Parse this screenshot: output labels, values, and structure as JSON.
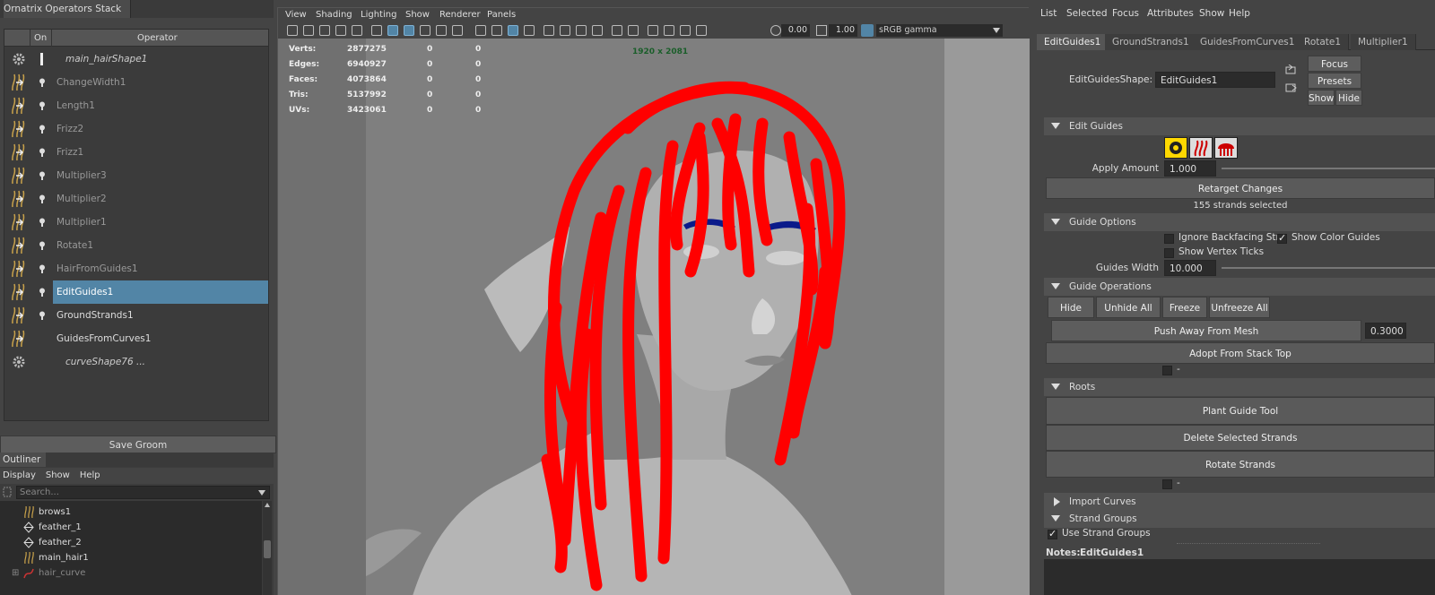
{
  "ornatrix": {
    "title": "Ornatrix Operators Stack",
    "col_on": "On",
    "col_operator": "Operator",
    "operators": [
      {
        "name": "main_hairShape1",
        "icon": "gear-icon"
      },
      {
        "name": "ChangeWidth1",
        "icon": "change-width-icon"
      },
      {
        "name": "Length1",
        "icon": "length-icon"
      },
      {
        "name": "Frizz2",
        "icon": "frizz-icon"
      },
      {
        "name": "Frizz1",
        "icon": "frizz-icon"
      },
      {
        "name": "Multiplier3",
        "icon": "multiplier-icon"
      },
      {
        "name": "Multiplier2",
        "icon": "multiplier-icon"
      },
      {
        "name": "Multiplier1",
        "icon": "multiplier-icon"
      },
      {
        "name": "Rotate1",
        "icon": "rotate-icon"
      },
      {
        "name": "HairFromGuides1",
        "icon": "hair-from-guides-icon"
      },
      {
        "name": "EditGuides1",
        "icon": "edit-guides-icon"
      },
      {
        "name": "GroundStrands1",
        "icon": "ground-strands-icon"
      },
      {
        "name": "GuidesFromCurves1",
        "icon": "guides-from-curves-icon"
      },
      {
        "name": "curveShape76 ...",
        "icon": "gear-icon"
      }
    ],
    "save_label": "Save Groom"
  },
  "outliner": {
    "title": "Outliner",
    "menu": [
      "Display",
      "Show",
      "Help"
    ],
    "search_placeholder": "Search...",
    "items": [
      {
        "name": "brows1",
        "icon": "hair-icon"
      },
      {
        "name": "feather_1",
        "icon": "mesh-icon"
      },
      {
        "name": "feather_2",
        "icon": "mesh-icon"
      },
      {
        "name": "main_hair1",
        "icon": "hair-icon"
      },
      {
        "name": "hair_curve",
        "icon": "curve-icon"
      }
    ]
  },
  "viewport": {
    "menu": [
      "View",
      "Shading",
      "Lighting",
      "Show",
      "Renderer",
      "Panels"
    ],
    "exposure": "0.00",
    "gamma": "1.00",
    "color_space": "sRGB gamma",
    "resolution": "1920 x 2081",
    "hud": [
      {
        "label": "Verts:",
        "v1": "2877275",
        "v2": "0",
        "v3": "0"
      },
      {
        "label": "Edges:",
        "v1": "6940927",
        "v2": "0",
        "v3": "0"
      },
      {
        "label": "Faces:",
        "v1": "4073864",
        "v2": "0",
        "v3": "0"
      },
      {
        "label": "Tris:",
        "v1": "5137992",
        "v2": "0",
        "v3": "0"
      },
      {
        "label": "UVs:",
        "v1": "3423061",
        "v2": "0",
        "v3": "0"
      }
    ],
    "colors": {
      "hair": "#ff0000",
      "brows": "#0a1a8a",
      "skin": "#9a9a9a",
      "bg": "#707070"
    }
  },
  "attr": {
    "menu": [
      "List",
      "Selected",
      "Focus",
      "Attributes",
      "Show",
      "Help"
    ],
    "tabs": [
      "EditGuides1",
      "GroundStrands1",
      "GuidesFromCurves1",
      "Rotate1",
      "Multiplier1"
    ],
    "shape_label": "EditGuidesShape:",
    "shape_value": "EditGuides1",
    "focus": "Focus",
    "presets": "Presets",
    "show": "Show",
    "hide": "Hide",
    "edit_guides": {
      "title": "Edit Guides",
      "apply_amount_label": "Apply Amount",
      "apply_amount": "1.000",
      "retarget": "Retarget Changes",
      "status": "155 strands selected"
    },
    "guide_options": {
      "title": "Guide Options",
      "ignore_backfacing": "Ignore Backfacing Strar",
      "show_color_guides": "Show Color Guides",
      "show_vertex_ticks": "Show Vertex Ticks",
      "guides_width_label": "Guides Width",
      "guides_width": "10.000"
    },
    "guide_operations": {
      "title": "Guide Operations",
      "hide": "Hide",
      "unhide_all": "Unhide All",
      "freeze": "Freeze",
      "unfreeze_all": "Unfreeze All",
      "push_away": "Push Away From Mesh",
      "push_value": "0.3000",
      "adopt": "Adopt From Stack Top",
      "dash": "-"
    },
    "roots": {
      "title": "Roots",
      "plant": "Plant Guide Tool",
      "delete": "Delete Selected Strands",
      "rotate": "Rotate Strands",
      "dash": "-"
    },
    "import_curves": "Import Curves",
    "strand_groups": {
      "title": "Strand Groups",
      "use": "Use Strand Groups"
    },
    "notes_label": "Notes:",
    "notes_value": "EditGuides1"
  }
}
